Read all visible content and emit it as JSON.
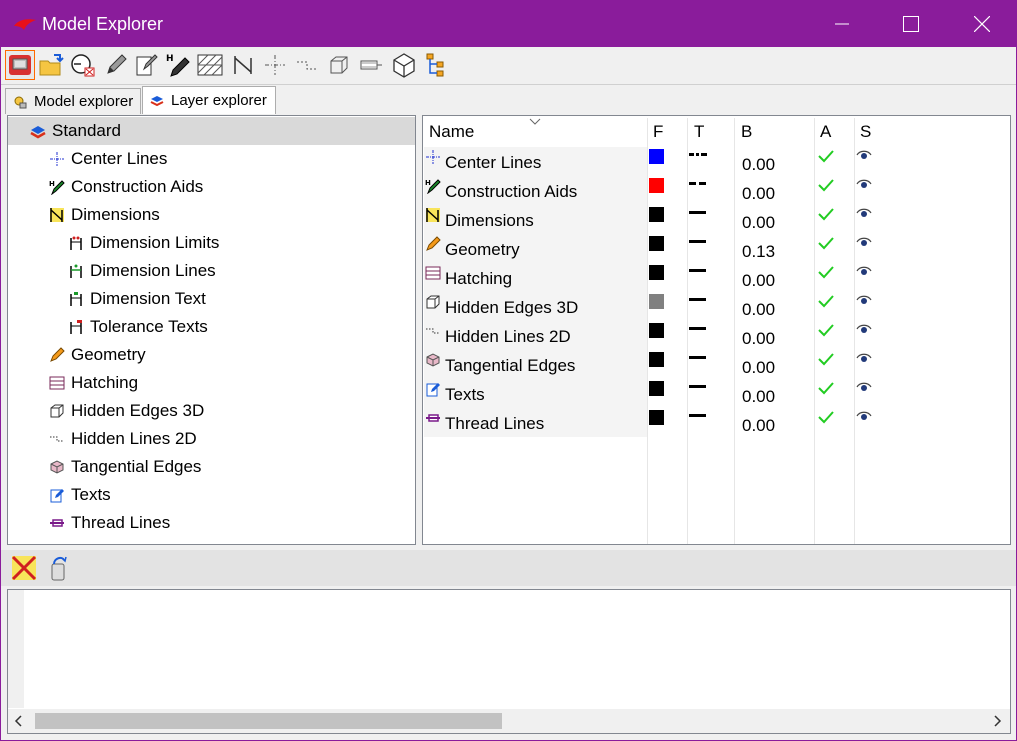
{
  "window": {
    "title": "Model Explorer",
    "accent": "#8a1c9b"
  },
  "toolbar": {
    "icons": [
      "model-view-icon",
      "open-folder-icon",
      "clock-target-icon",
      "pencil-icon",
      "edit-document-icon",
      "pen-h-icon",
      "hatch-icon",
      "dimension-icon",
      "center-line-icon",
      "hidden-line-icon",
      "hidden-edge-3d-icon",
      "thread-icon",
      "tangent-edge-icon",
      "tree-structure-icon"
    ]
  },
  "tabs": [
    {
      "label": "Model explorer",
      "active": false
    },
    {
      "label": "Layer explorer",
      "active": true
    }
  ],
  "tree": {
    "root": "Standard",
    "items": [
      {
        "label": "Center Lines",
        "indent": 1
      },
      {
        "label": "Construction Aids",
        "indent": 1
      },
      {
        "label": "Dimensions",
        "indent": 1
      },
      {
        "label": "Dimension Limits",
        "indent": 2
      },
      {
        "label": "Dimension Lines",
        "indent": 2
      },
      {
        "label": "Dimension Text",
        "indent": 2
      },
      {
        "label": "Tolerance Texts",
        "indent": 2
      },
      {
        "label": "Geometry",
        "indent": 1
      },
      {
        "label": "Hatching",
        "indent": 1
      },
      {
        "label": "Hidden Edges 3D",
        "indent": 1
      },
      {
        "label": "Hidden Lines 2D",
        "indent": 1
      },
      {
        "label": "Tangential Edges",
        "indent": 1
      },
      {
        "label": "Texts",
        "indent": 1
      },
      {
        "label": "Thread Lines",
        "indent": 1
      }
    ]
  },
  "layers": {
    "columns": {
      "name": "Name",
      "f": "F",
      "t": "T",
      "b": "B",
      "a": "A",
      "s": "S"
    },
    "rows": [
      {
        "name": "Center Lines",
        "color": "#0000ff",
        "line": "dash-dot",
        "b": "0.00"
      },
      {
        "name": "Construction Aids",
        "color": "#ff0000",
        "line": "dashed",
        "b": "0.00"
      },
      {
        "name": "Dimensions",
        "color": "#000000",
        "line": "solid",
        "b": "0.00"
      },
      {
        "name": "Geometry",
        "color": "#000000",
        "line": "solid",
        "b": "0.13"
      },
      {
        "name": "Hatching",
        "color": "#000000",
        "line": "solid",
        "b": "0.00"
      },
      {
        "name": "Hidden Edges 3D",
        "color": "#808080",
        "line": "solid",
        "b": "0.00"
      },
      {
        "name": "Hidden Lines 2D",
        "color": "#000000",
        "line": "solid",
        "b": "0.00"
      },
      {
        "name": "Tangential Edges",
        "color": "#000000",
        "line": "solid",
        "b": "0.00"
      },
      {
        "name": "Texts",
        "color": "#000000",
        "line": "solid",
        "b": "0.00"
      },
      {
        "name": "Thread Lines",
        "color": "#000000",
        "line": "solid",
        "b": "0.00"
      }
    ]
  },
  "bottom_toolbar": {
    "icons": [
      "delete-layer-icon",
      "clean-up-icon"
    ]
  }
}
